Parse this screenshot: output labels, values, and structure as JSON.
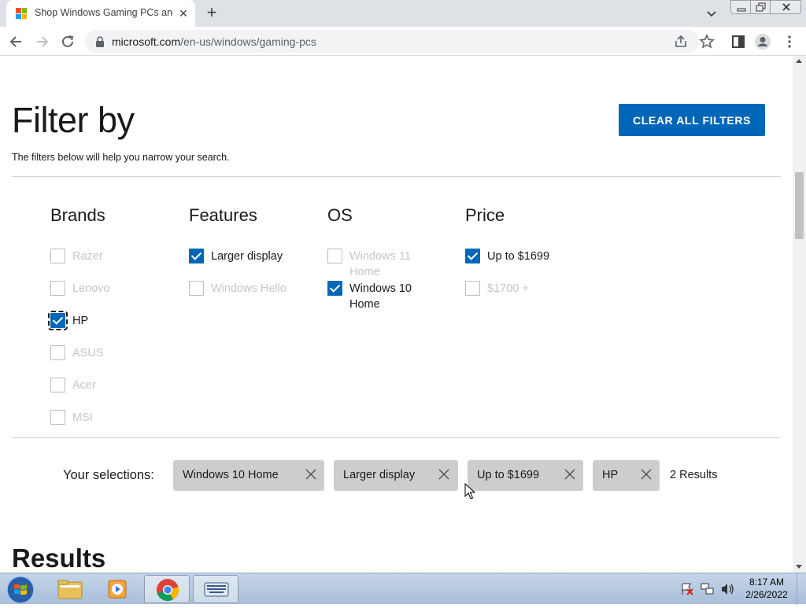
{
  "browser": {
    "tab_title": "Shop Windows Gaming PCs and",
    "url_host": "microsoft.com",
    "url_path": "/en-us/windows/gaming-pcs",
    "icons": [
      "back-icon",
      "forward-icon",
      "reload-icon",
      "lock-icon",
      "share-icon",
      "star-icon",
      "side-panel-icon",
      "profile-icon",
      "menu-icon"
    ]
  },
  "filter": {
    "title": "Filter by",
    "subtitle": "The filters below will help you narrow your search.",
    "clear_label": "CLEAR ALL FILTERS"
  },
  "brands": {
    "heading": "Brands",
    "options": [
      {
        "label": "Razer",
        "checked": false
      },
      {
        "label": "Lenovo",
        "checked": false
      },
      {
        "label": "HP",
        "checked": true
      },
      {
        "label": "ASUS",
        "checked": false
      },
      {
        "label": "Acer",
        "checked": false
      },
      {
        "label": "MSI",
        "checked": false
      }
    ]
  },
  "features": {
    "heading": "Features",
    "options": [
      {
        "label": "Larger display",
        "checked": true
      },
      {
        "label": "Windows Hello",
        "checked": false
      }
    ]
  },
  "os": {
    "heading": "OS",
    "options": [
      {
        "label": "Windows 11 Home",
        "checked": false
      },
      {
        "label": "Windows 10 Home",
        "checked": true
      }
    ]
  },
  "price": {
    "heading": "Price",
    "options": [
      {
        "label": "Up to $1699",
        "checked": true
      },
      {
        "label": "$1700 +",
        "checked": false
      }
    ]
  },
  "selections": {
    "label": "Your selections:",
    "chips": [
      "Windows 10 Home",
      "Larger display",
      "Up to $1699",
      "HP"
    ],
    "results_count": "2 Results"
  },
  "results": {
    "title": "Results"
  },
  "taskbar": {
    "time": "8:17 AM",
    "date": "2/26/2022"
  },
  "colors": {
    "accent": "#0067b8",
    "chip": "#cdcdcd",
    "disabled_text": "#c6c6c6"
  }
}
